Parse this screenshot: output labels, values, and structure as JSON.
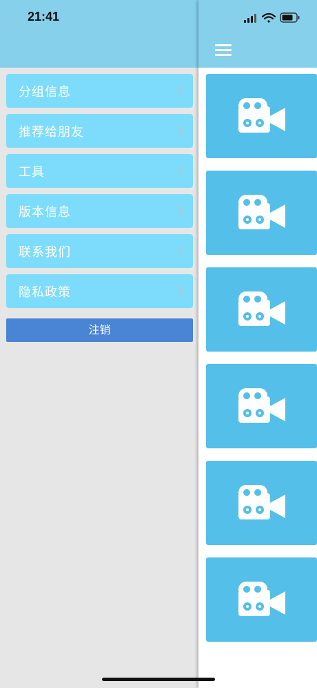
{
  "status_bar": {
    "time": "21:41"
  },
  "drawer": {
    "items": [
      {
        "label": "分组信息"
      },
      {
        "label": "推荐给朋友"
      },
      {
        "label": "工具"
      },
      {
        "label": "版本信息"
      },
      {
        "label": "联系我们"
      },
      {
        "label": "隐私政策"
      }
    ],
    "logout_label": "注销"
  },
  "main": {
    "cards": [
      {
        "icon": "video-camera-icon"
      },
      {
        "icon": "video-camera-icon"
      },
      {
        "icon": "video-camera-icon"
      },
      {
        "icon": "video-camera-icon"
      },
      {
        "icon": "video-camera-icon"
      },
      {
        "icon": "video-camera-icon"
      }
    ]
  },
  "colors": {
    "header": "#86d0ec",
    "menu_item": "#7ddcfb",
    "logout": "#4a84d4",
    "card": "#54bfe8"
  }
}
